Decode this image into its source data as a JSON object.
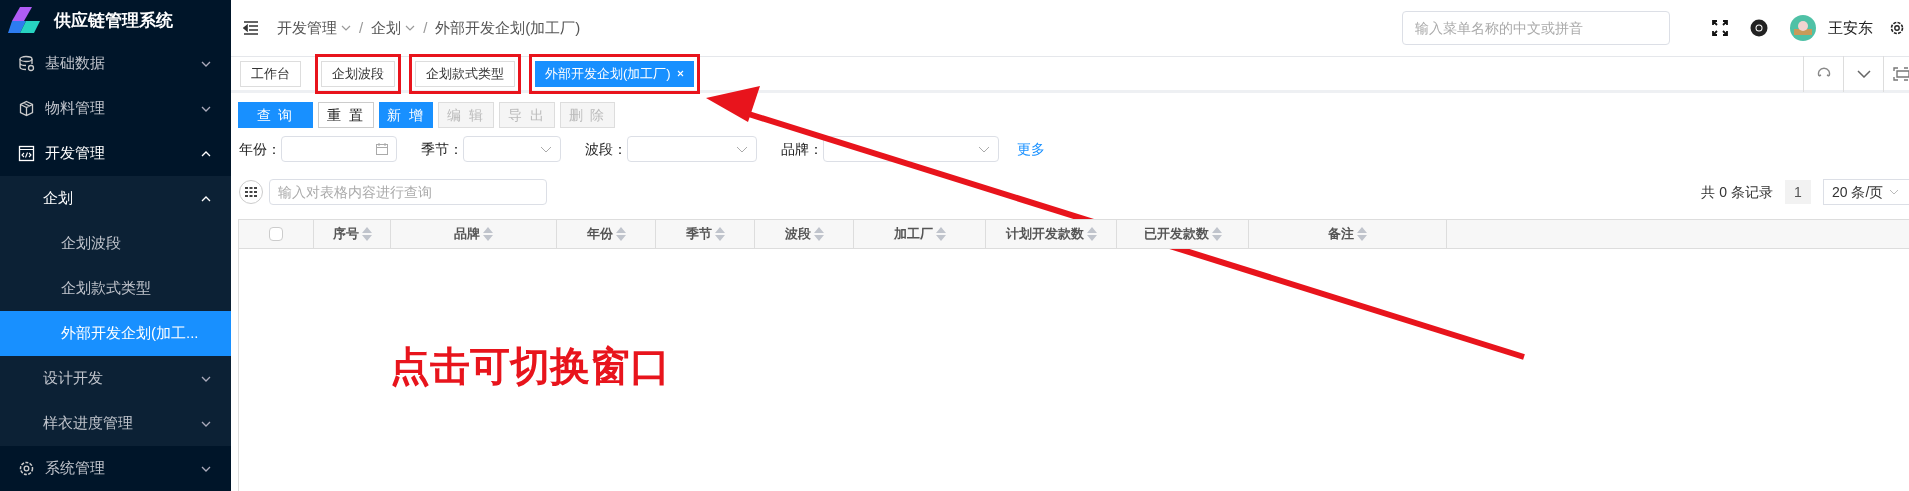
{
  "app": {
    "title": "供应链管理系统"
  },
  "sidebar": {
    "items": [
      {
        "label": "基础数据",
        "expanded": false,
        "selected": false
      },
      {
        "label": "物料管理",
        "expanded": false,
        "selected": false
      },
      {
        "label": "开发管理",
        "expanded": true,
        "selected": false,
        "children": [
          {
            "label": "企划",
            "expanded": true,
            "selected": false,
            "children": [
              {
                "label": "企划波段",
                "selected": false
              },
              {
                "label": "企划款式类型",
                "selected": false
              },
              {
                "label": "外部开发企划(加工...",
                "selected": true
              }
            ]
          },
          {
            "label": "设计开发",
            "expanded": false,
            "selected": false
          },
          {
            "label": "样衣进度管理",
            "expanded": false,
            "selected": false
          }
        ]
      },
      {
        "label": "系统管理",
        "expanded": false,
        "selected": false
      }
    ]
  },
  "breadcrumb": [
    {
      "label": "开发管理",
      "dropdown": true
    },
    {
      "separator": "/",
      "label": "企划",
      "dropdown": true
    },
    {
      "separator": "/",
      "label": "外部开发企划(加工厂)",
      "dropdown": false
    }
  ],
  "menu_search": {
    "placeholder": "输入菜单名称的中文或拼音"
  },
  "user": {
    "name": "王安东"
  },
  "tabs": [
    {
      "label": "工作台",
      "selected": false,
      "closable": false,
      "annotated": false
    },
    {
      "label": "企划波段",
      "selected": false,
      "closable": false,
      "annotated": true
    },
    {
      "label": "企划款式类型",
      "selected": false,
      "closable": false,
      "annotated": true
    },
    {
      "label": "外部开发企划(加工厂)",
      "selected": true,
      "closable": true,
      "annotated": true
    }
  ],
  "toolbar": [
    {
      "label": "查 询",
      "kind": "primary",
      "disabled": false
    },
    {
      "label": "重 置",
      "kind": "default",
      "disabled": false
    },
    {
      "label": "新 增",
      "kind": "primary",
      "disabled": false
    },
    {
      "label": "编 辑",
      "kind": "default",
      "disabled": true
    },
    {
      "label": "导 出",
      "kind": "default",
      "disabled": true
    },
    {
      "label": "删 除",
      "kind": "default",
      "disabled": true
    }
  ],
  "filters": [
    {
      "label": "年份：",
      "kind": "date"
    },
    {
      "label": "季节：",
      "kind": "select"
    },
    {
      "label": "波段：",
      "kind": "select"
    },
    {
      "label": "品牌：",
      "kind": "select"
    }
  ],
  "more_link": "更多",
  "table_search": {
    "placeholder": "输入对表格内容进行查询"
  },
  "pagination": {
    "total": "共 0 条记录",
    "page": "1",
    "page_size": "20 条/页"
  },
  "table": {
    "columns": [
      "序号",
      "品牌",
      "年份",
      "季节",
      "波段",
      "加工厂",
      "计划开发款数",
      "已开发款数",
      "备注"
    ],
    "select_all_checked": false
  },
  "annotation": {
    "text": "点击可切换窗口"
  }
}
